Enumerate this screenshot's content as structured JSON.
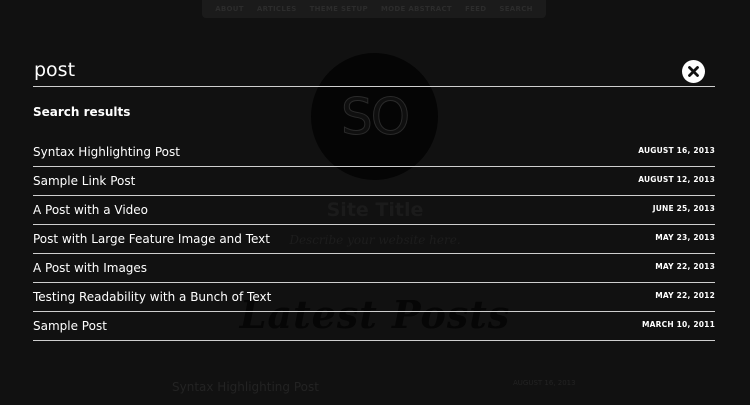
{
  "background": {
    "nav": {
      "items": [
        "ABOUT",
        "ARTICLES",
        "THEME SETUP",
        "MODE ABSTRACT",
        "FEED",
        "SEARCH"
      ]
    },
    "logo_text": "SO",
    "site_title": "Site Title",
    "tagline": "Describe your website here.",
    "section_heading": "Latest Posts",
    "first_post": {
      "title": "Syntax Highlighting Post",
      "date": "AUGUST 16, 2013"
    }
  },
  "search": {
    "query": "post",
    "results_heading": "Search results",
    "close_icon": "close-icon",
    "results": [
      {
        "title": "Syntax Highlighting Post",
        "date": "AUGUST 16, 2013"
      },
      {
        "title": "Sample Link Post",
        "date": "AUGUST 12, 2013"
      },
      {
        "title": "A Post with a Video",
        "date": "JUNE 25, 2013"
      },
      {
        "title": "Post with Large Feature Image and Text",
        "date": "MAY 23, 2013"
      },
      {
        "title": "A Post with Images",
        "date": "MAY 22, 2013"
      },
      {
        "title": "Testing Readability with a Bunch of Text",
        "date": "MAY 22, 2012"
      },
      {
        "title": "Sample Post",
        "date": "MARCH 10, 2011"
      }
    ]
  },
  "colors": {
    "overlay_background": "#111111",
    "text": "#ffffff",
    "divider": "#cfcfcf"
  }
}
